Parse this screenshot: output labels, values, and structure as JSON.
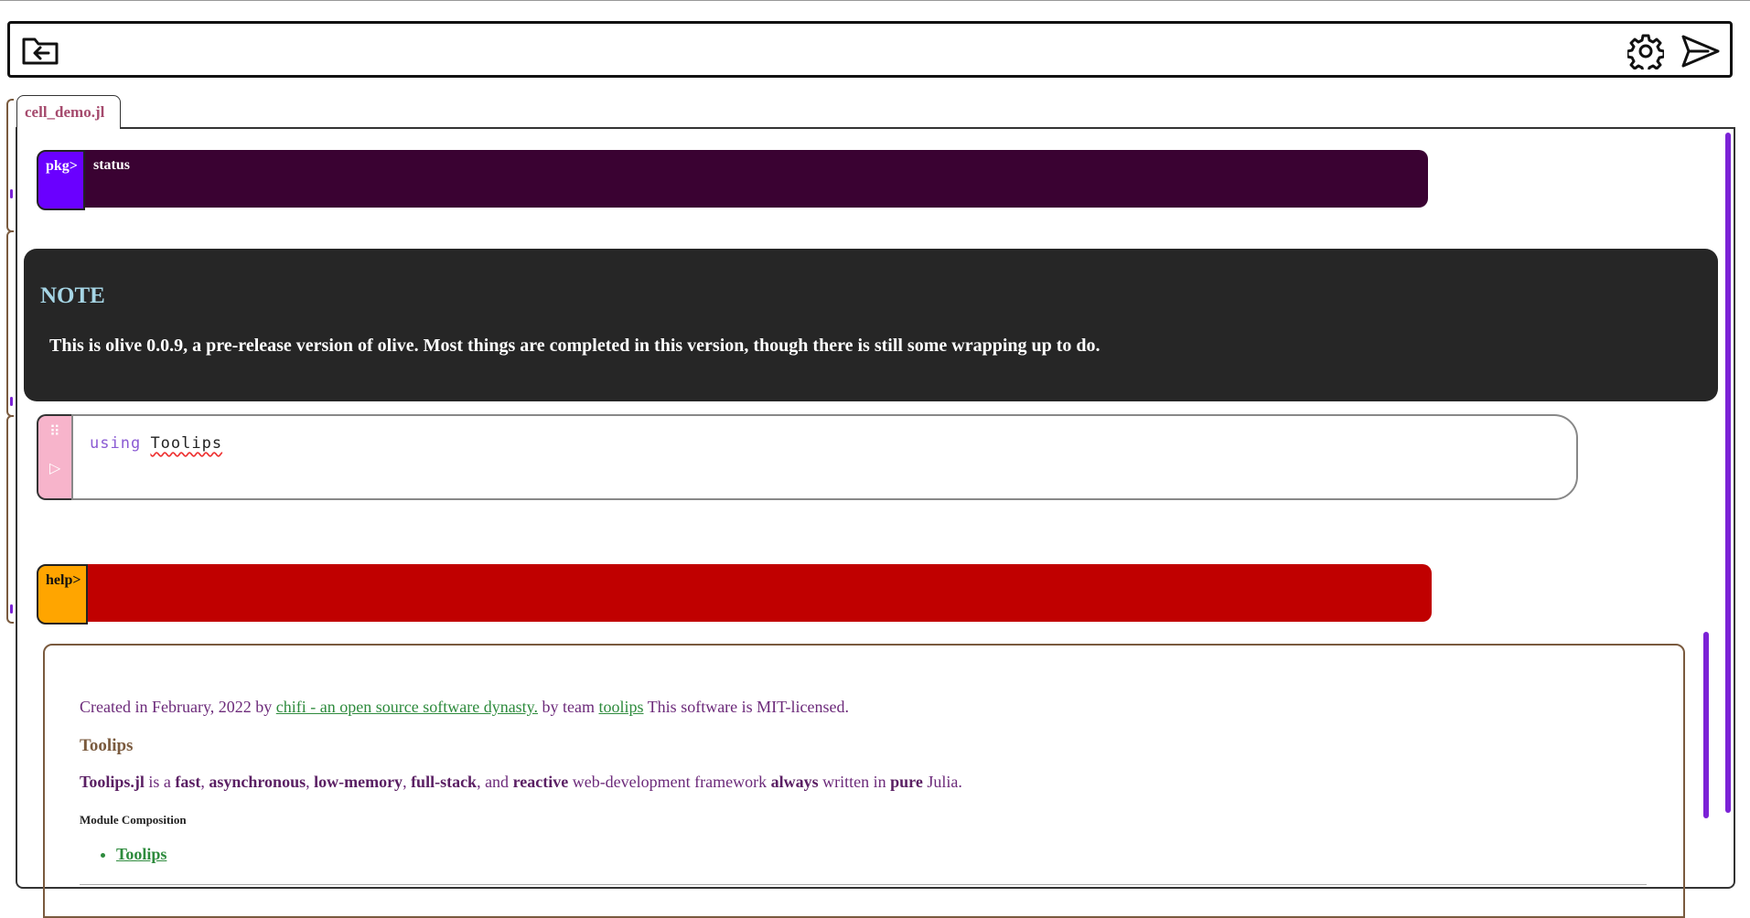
{
  "topbar": {
    "back_icon": "folder-back-icon",
    "settings_icon": "gear-icon",
    "send_icon": "send-icon"
  },
  "tab": {
    "label": "cell_demo.jl"
  },
  "cells": {
    "pkg": {
      "prompt": "pkg>",
      "input": "status",
      "label_color": "#6a00ff",
      "input_color": "#3a0232"
    },
    "note": {
      "title": "NOTE",
      "body": "This is olive 0.0.9, a pre-release version of olive. Most things are completed in this version, though there is still some wrapping up to do."
    },
    "code": {
      "keyword": "using",
      "identifier": "Toolips",
      "grip_icon": "drag-handle-icon",
      "run_icon": "run-icon"
    },
    "help": {
      "prompt": "help>",
      "label_color": "#ffa500",
      "input_color": "#c00000"
    }
  },
  "doc": {
    "line1": {
      "pre": "Created in February, 2022 by ",
      "link1": "chifi - an open source software dynasty.",
      "mid": " by team ",
      "link2": "toolips",
      "post": " This software is MIT-licensed."
    },
    "heading": "Toolips",
    "para": {
      "p1": "Toolips.jl",
      "t1": " is a ",
      "p2": "fast",
      "t2": ", ",
      "p3": "asynchronous",
      "t3": ", ",
      "p4": "low-memory",
      "t4": ", ",
      "p5": "full-stack",
      "t5": ", and ",
      "p6": "reactive",
      "t6": " web-development framework ",
      "p7": "always",
      "t7": " written in ",
      "p8": "pure",
      "t8": " Julia."
    },
    "subheading": "Module Composition",
    "list": [
      "Toolips"
    ]
  }
}
